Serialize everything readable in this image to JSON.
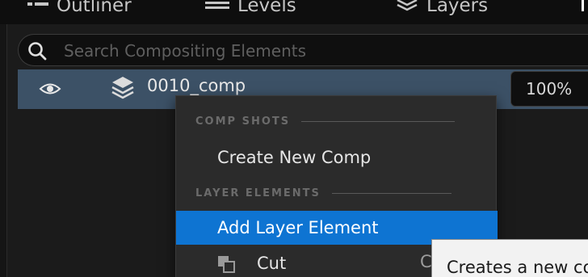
{
  "tabs": {
    "outliner": "Outliner",
    "levels": "Levels",
    "layers": "Layers"
  },
  "search": {
    "placeholder": "Search Compositing Elements",
    "value": ""
  },
  "row": {
    "name": "0010_comp",
    "opacity": "100%"
  },
  "menu": {
    "section_comp_shots": "COMP SHOTS",
    "create_new_comp": "Create New Comp",
    "section_layer_elements": "LAYER ELEMENTS",
    "add_layer_element": "Add Layer Element",
    "cut": "Cut",
    "cut_shortcut": "C"
  },
  "tooltip": {
    "text": "Creates a new co"
  },
  "colors": {
    "selected_row": "#3c5166",
    "highlight": "#0e74d2",
    "menu_bg": "#2b2b2b"
  },
  "icons": {
    "outliner": "list-icon",
    "levels": "levels-icon",
    "layers": "layers-icon",
    "search": "search-icon",
    "eye": "eye-icon",
    "comp": "layers-stack-icon",
    "cut": "cut-icon"
  }
}
